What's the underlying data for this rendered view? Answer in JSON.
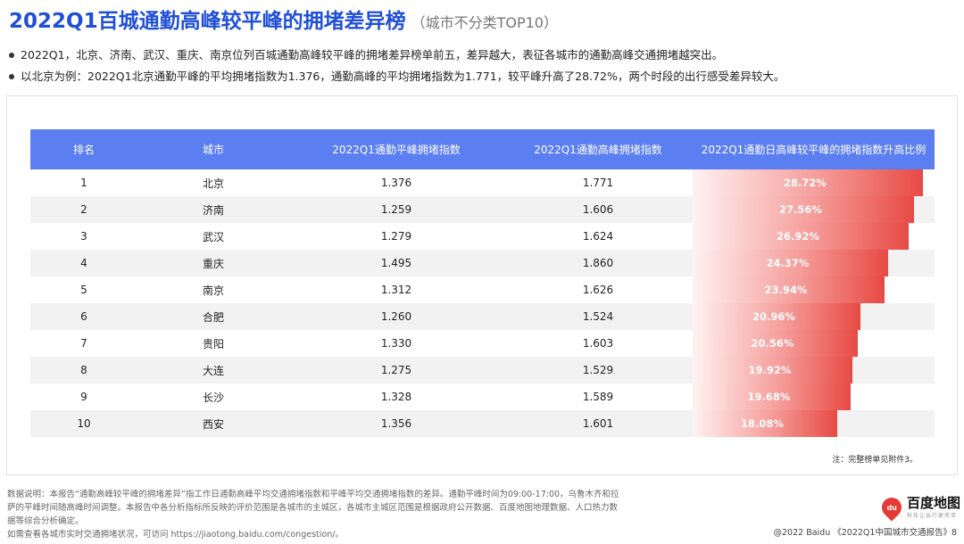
{
  "header": {
    "title": "2022Q1百城通勤高峰较平峰的拥堵差异榜",
    "subtitle": "（城市不分类TOP10）"
  },
  "bullets": [
    "2022Q1，北京、济南、武汉、重庆、南京位列百城通勤高峰较平峰的拥堵差异榜单前五，差异越大，表征各城市的通勤高峰交通拥堵越突出。",
    "以北京为例：2022Q1北京通勤平峰的平均拥堵指数为1.376，通勤高峰的平均拥堵指数为1.771，较平峰升高了28.72%，两个时段的出行感受差异较大。"
  ],
  "table": {
    "headers": [
      "排名",
      "城市",
      "2022Q1通勤平峰拥堵指数",
      "2022Q1通勤高峰拥堵指数",
      "2022Q1通勤日高峰较平峰的拥堵指数升高比例"
    ],
    "rows": [
      {
        "rank": "1",
        "city": "北京",
        "offpeak": "1.376",
        "peak": "1.771",
        "ratio": "28.72%",
        "ratio_value": 28.72
      },
      {
        "rank": "2",
        "city": "济南",
        "offpeak": "1.259",
        "peak": "1.606",
        "ratio": "27.56%",
        "ratio_value": 27.56
      },
      {
        "rank": "3",
        "city": "武汉",
        "offpeak": "1.279",
        "peak": "1.624",
        "ratio": "26.92%",
        "ratio_value": 26.92
      },
      {
        "rank": "4",
        "city": "重庆",
        "offpeak": "1.495",
        "peak": "1.860",
        "ratio": "24.37%",
        "ratio_value": 24.37
      },
      {
        "rank": "5",
        "city": "南京",
        "offpeak": "1.312",
        "peak": "1.626",
        "ratio": "23.94%",
        "ratio_value": 23.94
      },
      {
        "rank": "6",
        "city": "合肥",
        "offpeak": "1.260",
        "peak": "1.524",
        "ratio": "20.96%",
        "ratio_value": 20.96
      },
      {
        "rank": "7",
        "city": "贵阳",
        "offpeak": "1.330",
        "peak": "1.603",
        "ratio": "20.56%",
        "ratio_value": 20.56
      },
      {
        "rank": "8",
        "city": "大连",
        "offpeak": "1.275",
        "peak": "1.529",
        "ratio": "19.92%",
        "ratio_value": 19.92
      },
      {
        "rank": "9",
        "city": "长沙",
        "offpeak": "1.328",
        "peak": "1.589",
        "ratio": "19.68%",
        "ratio_value": 19.68
      },
      {
        "rank": "10",
        "city": "西安",
        "offpeak": "1.356",
        "peak": "1.601",
        "ratio": "18.08%",
        "ratio_value": 18.08
      }
    ],
    "note": "注：完整榜单见附件3。"
  },
  "footnote": {
    "line1": "数据说明：本报告“通勤高峰较平峰的拥堵差异”指工作日通勤高峰平均交通拥堵指数和平峰平均交通拥堵指数的差异。通勤平峰时间为09:00-17:00，乌鲁木齐和拉萨的平峰时间随高峰时间调整。本报告中各分析指标所反映的评价范围是各城市的主城区，各城市主城区范围是根据政府公开数据、百度地图地理数据、人口热力数据等综合分析确定。",
    "line2": "如需查看各城市实时交通拥堵状况，可访问 https://jiaotong.baidu.com/congestion/。"
  },
  "brand": {
    "pin_text": "du",
    "name": "百度地图",
    "slogan": "科技让出行更简单",
    "color": "#e53935"
  },
  "copyright": "@2022 Baidu 《2022Q1中国城市交通报告》8",
  "colors": {
    "title": "#1f4fd6",
    "table_header": "#5b7ef0",
    "bar_end": "#e84a44"
  }
}
